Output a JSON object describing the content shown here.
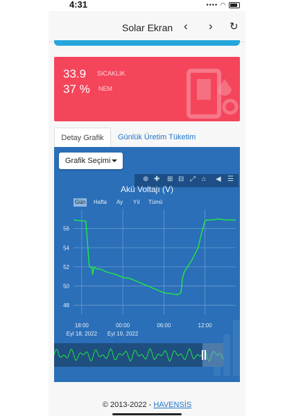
{
  "status_bar": {
    "time": "4:31"
  },
  "header": {
    "title": "Solar Ekran",
    "back_icon": "chevron-left-icon",
    "forward_icon": "chevron-right-icon",
    "refresh_icon": "refresh-icon"
  },
  "sensor_card": {
    "temperature_value": "33.9",
    "temperature_label": "SICAKLIK",
    "humidity_value": "37 %",
    "humidity_label": "NEM",
    "background_color": "#f4455b"
  },
  "tabs": [
    {
      "label": "Detay Grafik",
      "active": true
    },
    {
      "label": "Günlük Üretim Tüketim",
      "active": false
    }
  ],
  "chart_panel": {
    "select_label": "Grafik Seçimi",
    "range_buttons": [
      "Gün",
      "Hafta",
      "Ay",
      "Yıl",
      "Tümü"
    ],
    "selected_range": "Gün",
    "panel_color": "#2a6fb8",
    "line_color": "#22e34a"
  },
  "chart_data": {
    "type": "line",
    "title": "Akü Voltajı (V)",
    "ylim": [
      47,
      58
    ],
    "yticks": [
      48,
      50,
      52,
      54,
      56
    ],
    "xticks": [
      {
        "label": "18:00",
        "date": "Eyl 18, 2022",
        "t": 0
      },
      {
        "label": "00:00",
        "date": "Eyl 19, 2022",
        "t": 6
      },
      {
        "label": "06:00",
        "date": "",
        "t": 12
      },
      {
        "label": "12:00",
        "date": "",
        "t": 18
      }
    ],
    "xlim": [
      -1.2,
      22.5
    ],
    "grid": true,
    "series": [
      {
        "x": [
          -1.2,
          0,
          0.6,
          0.8,
          1.1,
          1.3,
          1.5,
          1.6,
          1.8,
          2.1,
          2.5,
          3,
          3.5,
          4,
          5,
          6,
          7,
          8,
          9,
          10,
          11,
          12,
          13,
          14,
          14.5,
          14.7,
          15,
          16,
          17,
          17.5,
          18,
          18.3,
          19,
          20,
          21,
          22.5
        ],
        "y": [
          56.9,
          56.8,
          56.8,
          55.0,
          52.1,
          51.9,
          52.0,
          51.2,
          52.0,
          51.8,
          51.8,
          51.7,
          51.5,
          51.4,
          51.2,
          50.9,
          50.8,
          50.5,
          50.2,
          49.9,
          49.6,
          49.3,
          49.2,
          49.1,
          49.3,
          50.8,
          51.5,
          52.6,
          54.0,
          55.5,
          56.8,
          56.9,
          56.9,
          57.0,
          56.9,
          56.9
        ]
      }
    ]
  },
  "footer": {
    "copyright": "© 2013-2022 - ",
    "link": "HAVENSİS"
  }
}
